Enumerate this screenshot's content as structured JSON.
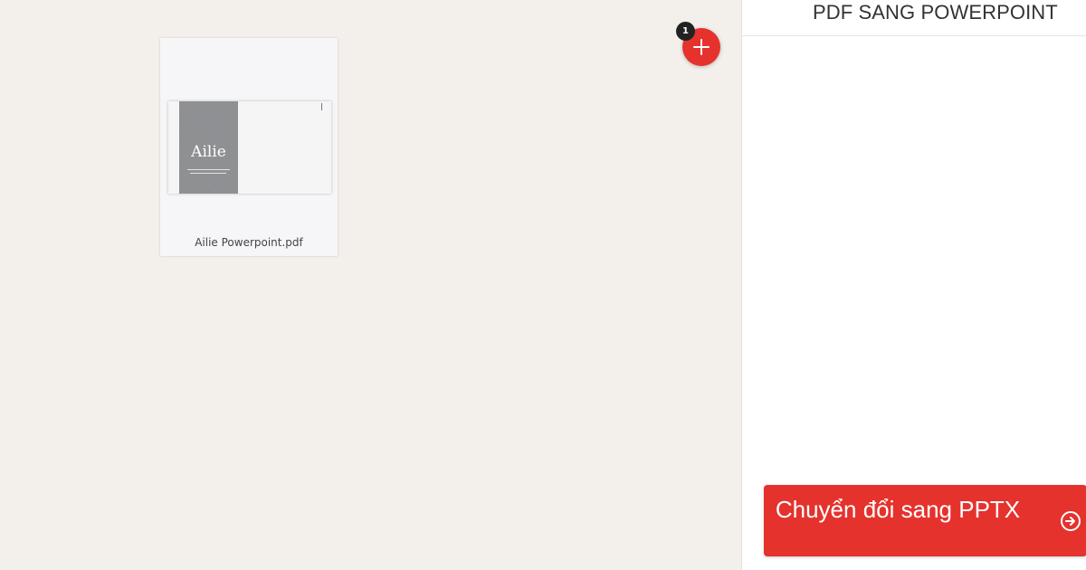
{
  "workspace": {
    "files": [
      {
        "name": "Ailie Powerpoint.pdf",
        "thumbnail": {
          "title": "Ailie"
        }
      }
    ],
    "add_button": {
      "icon": "plus-icon",
      "count": "1"
    }
  },
  "sidebar": {
    "title": "PDF SANG POWERPOINT",
    "convert_button": {
      "label": "Chuyển đổi sang PPTX",
      "icon": "arrow-right-circle-icon"
    }
  },
  "colors": {
    "accent": "#e5322d",
    "workspace_bg": "#f3f0ec",
    "badge": "#222222"
  }
}
